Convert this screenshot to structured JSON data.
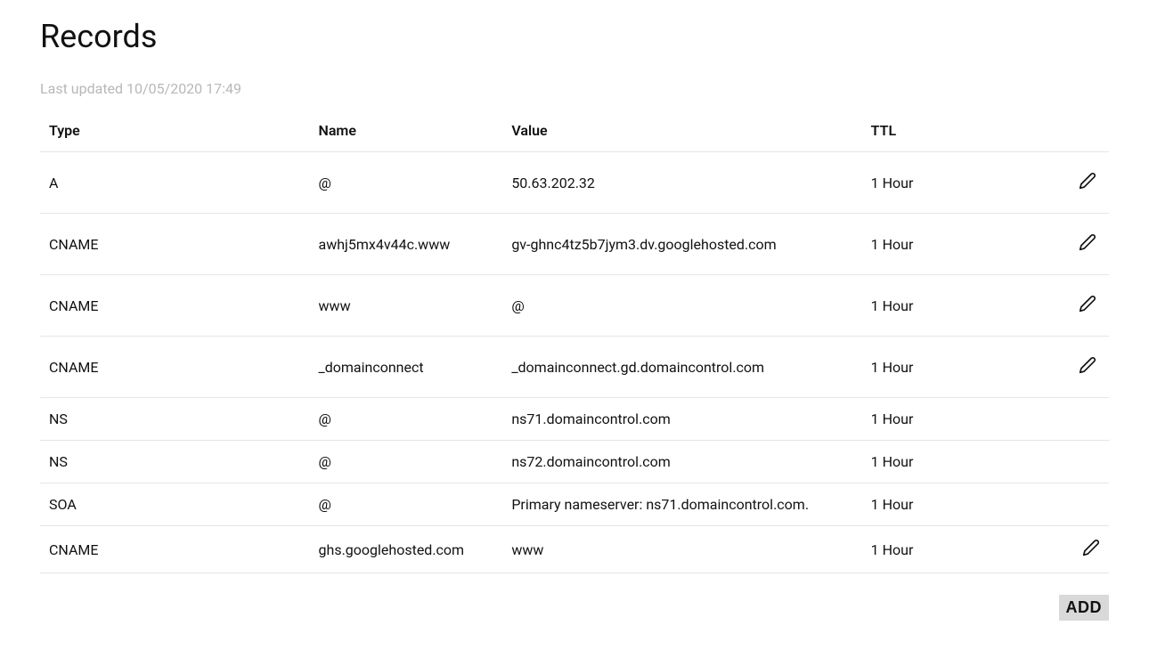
{
  "title": "Records",
  "last_updated": "Last updated 10/05/2020 17:49",
  "columns": {
    "type": "Type",
    "name": "Name",
    "value": "Value",
    "ttl": "TTL"
  },
  "records": [
    {
      "type": "A",
      "name": "@",
      "value": "50.63.202.32",
      "ttl": "1 Hour",
      "editable": true,
      "compact": false
    },
    {
      "type": "CNAME",
      "name": "awhj5mx4v44c.www",
      "value": "gv-ghnc4tz5b7jym3.dv.googlehosted.com",
      "ttl": "1 Hour",
      "editable": true,
      "compact": false
    },
    {
      "type": "CNAME",
      "name": "www",
      "value": "@",
      "ttl": "1 Hour",
      "editable": true,
      "compact": false
    },
    {
      "type": "CNAME",
      "name": "_domainconnect",
      "value": "_domainconnect.gd.domaincontrol.com",
      "ttl": "1 Hour",
      "editable": true,
      "compact": false
    },
    {
      "type": "NS",
      "name": "@",
      "value": "ns71.domaincontrol.com",
      "ttl": "1 Hour",
      "editable": false,
      "compact": true
    },
    {
      "type": "NS",
      "name": "@",
      "value": "ns72.domaincontrol.com",
      "ttl": "1 Hour",
      "editable": false,
      "compact": true
    },
    {
      "type": "SOA",
      "name": "@",
      "value": "Primary nameserver: ns71.domaincontrol.com.",
      "ttl": "1 Hour",
      "editable": false,
      "compact": true
    },
    {
      "type": "CNAME",
      "name": "ghs.googlehosted.com",
      "value": "www",
      "ttl": "1 Hour",
      "editable": true,
      "compact": true
    }
  ],
  "add_label": "ADD"
}
